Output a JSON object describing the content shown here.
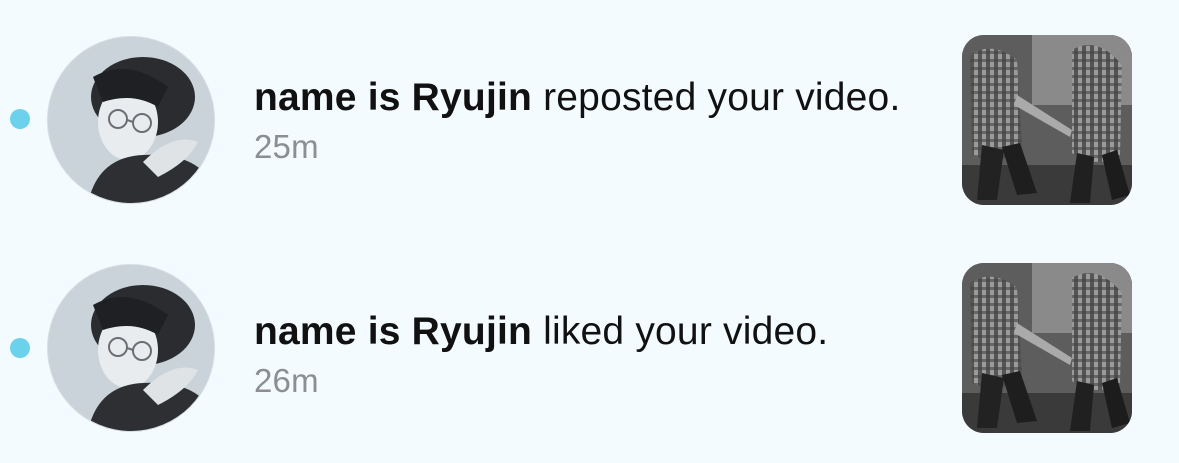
{
  "notifications": [
    {
      "username": "name is Ryujin",
      "action": " reposted your video.",
      "time": "25m",
      "unread": true,
      "avatar_icon": "profile-photo",
      "thumbnail_icon": "video-thumbnail"
    },
    {
      "username": "name is Ryujin",
      "action": " liked your video.",
      "time": "26m",
      "unread": true,
      "avatar_icon": "profile-photo",
      "thumbnail_icon": "video-thumbnail"
    }
  ],
  "colors": {
    "background": "#f3fbfe",
    "unread_dot": "#6cd2ec",
    "text": "#111111",
    "timestamp": "#8b8f93"
  }
}
